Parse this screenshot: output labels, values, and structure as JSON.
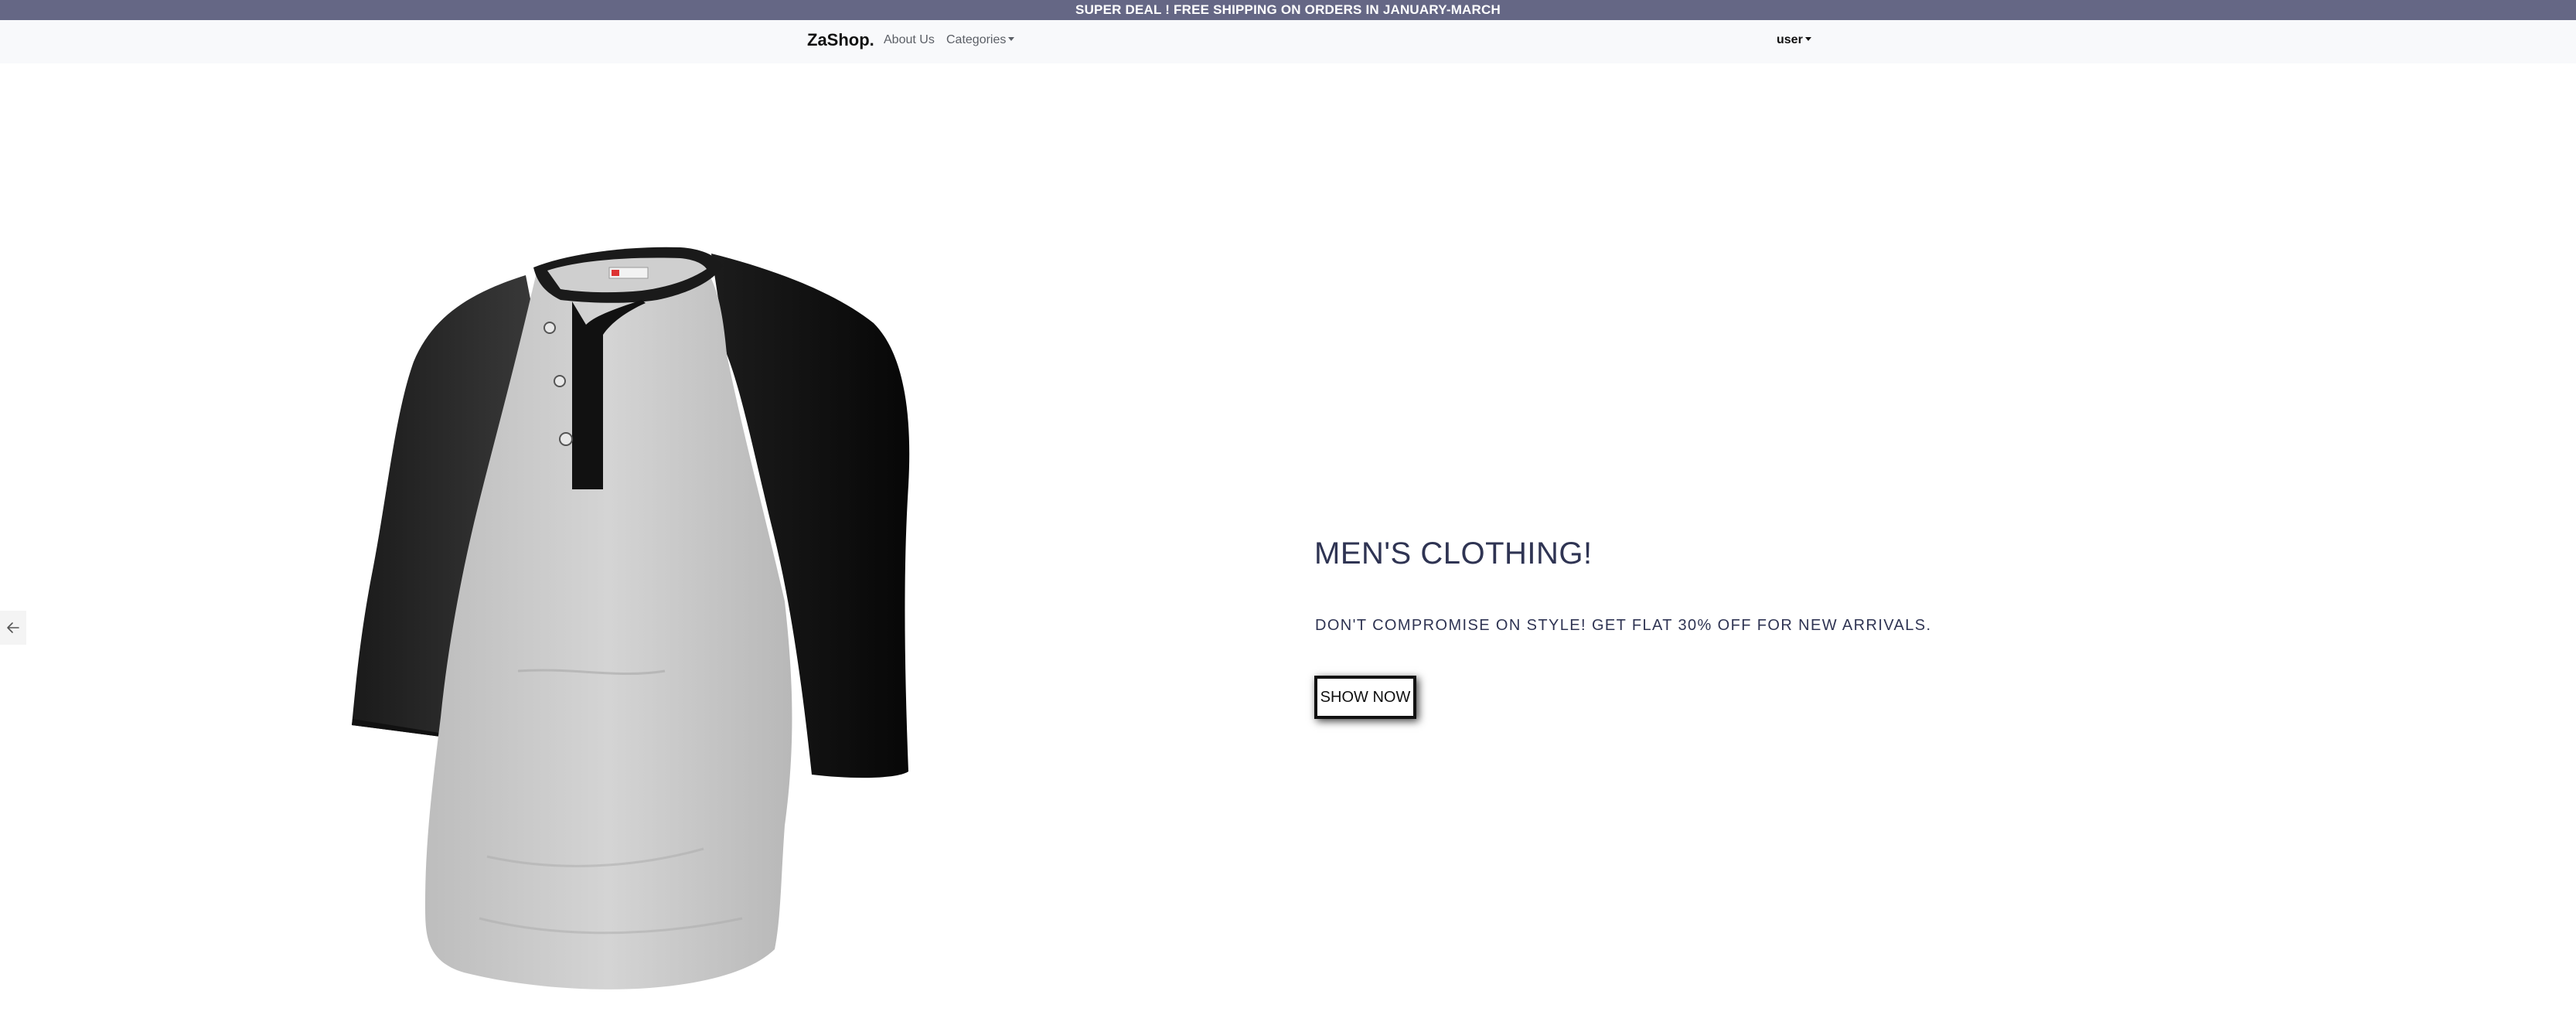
{
  "announcement": {
    "text": "SUPER DEAL ! FREE SHIPPING ON ORDERS IN JANUARY-MARCH"
  },
  "navbar": {
    "brand": "ZaShop.",
    "about": "About Us",
    "categories": "Categories",
    "user": "user"
  },
  "carousel": {
    "title": "MEN'S CLOTHING!",
    "subtitle": "DON'T COMPROMISE ON STYLE! GET FLAT 30% OFF FOR NEW ARRIVALS.",
    "button_label": "SHOW NOW",
    "image_icon": "henley-shirt-image",
    "prev_icon": "arrow-left-icon"
  },
  "colors": {
    "announcement_bg": "#656785",
    "navbar_bg": "#f8f9fb",
    "title": "#2f3453"
  }
}
